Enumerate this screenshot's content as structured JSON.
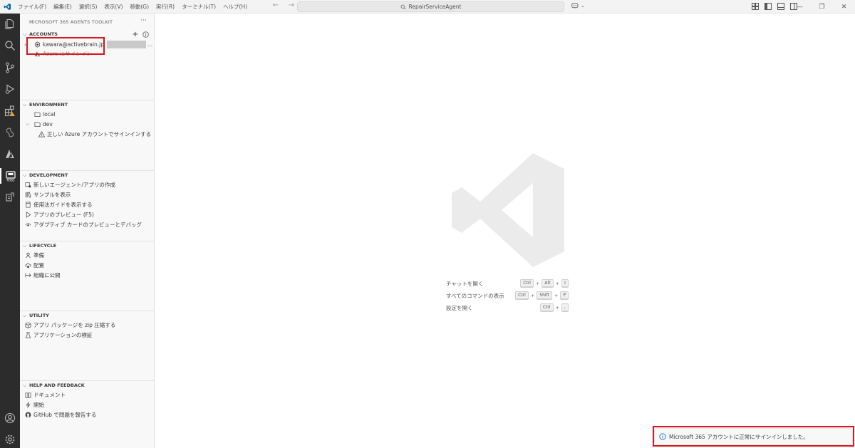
{
  "titlebar": {
    "menu": [
      "ファイル(F)",
      "編集(E)",
      "選択(S)",
      "表示(V)",
      "移動(G)",
      "実行(R)",
      "ターミナル(T)",
      "ヘルプ(H)"
    ],
    "search_text": "RepairServiceAgent"
  },
  "sidebar": {
    "title": "MICROSOFT 365 AGENTS TOOLKIT",
    "accounts": {
      "header": "ACCOUNTS",
      "m365_account": "kawara@activebrain.jp",
      "m365_account_suffix": "...",
      "azure_account": "Azure にサインイン"
    },
    "environment": {
      "header": "ENVIRONMENT",
      "items": [
        "local",
        "dev"
      ],
      "dev_warning": "正しい Azure アカウントでサインインする"
    },
    "development": {
      "header": "DEVELOPMENT",
      "items": [
        "新しいエージェント/アプリの作成",
        "サンプルを表示",
        "使用法ガイドを表示する",
        "アプリのプレビュー (F5)",
        "アダプティブ カードのプレビューとデバッグ"
      ]
    },
    "lifecycle": {
      "header": "LIFECYCLE",
      "items": [
        "準備",
        "配置",
        "組織に公開"
      ]
    },
    "utility": {
      "header": "UTILITY",
      "items": [
        "アプリ パッケージを zip 圧縮する",
        "アプリケーションの検証"
      ]
    },
    "help": {
      "header": "HELP AND FEEDBACK",
      "items": [
        "ドキュメント",
        "開始",
        "GitHub で問題を報告する"
      ]
    }
  },
  "editor": {
    "shortcuts": [
      {
        "label": "チャットを開く",
        "keys": [
          "Ctrl",
          "Alt",
          "I"
        ]
      },
      {
        "label": "すべてのコマンドの表示",
        "keys": [
          "Ctrl",
          "Shift",
          "P"
        ]
      },
      {
        "label": "設定を開く",
        "keys": [
          "Ctrl",
          ","
        ]
      }
    ]
  },
  "notification": {
    "text": "Microsoft 365 アカウントに正常にサインインしました。"
  },
  "colors": {
    "activity_bar": "#2c2c2c",
    "highlight": "#d9141c",
    "vscode_blue": "#0065a9",
    "warning": "#e8a33d"
  }
}
